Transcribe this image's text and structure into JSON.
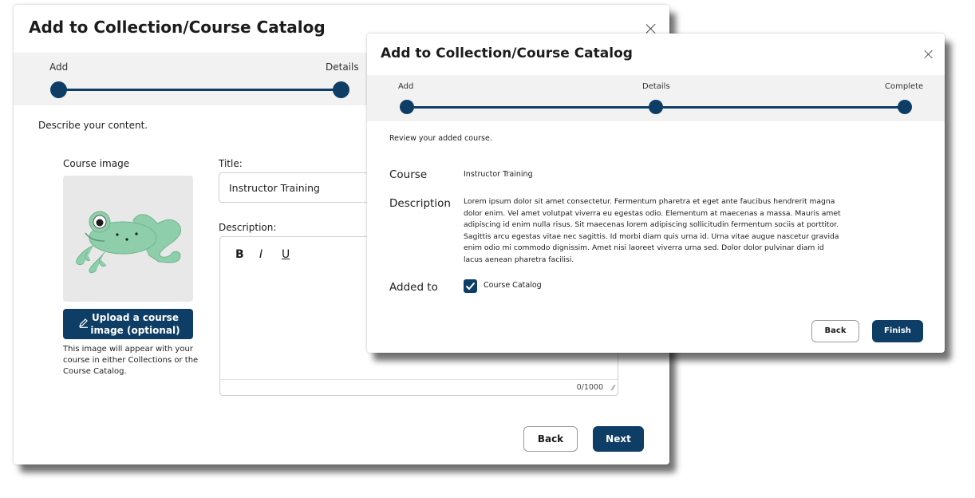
{
  "colors": {
    "accent": "#0e3d66",
    "band": "#f2f2f2"
  },
  "back_modal": {
    "title": "Add to Collection/Course Catalog",
    "steps": [
      "Add",
      "Details"
    ],
    "instruction": "Describe your content.",
    "course_image_label": "Course image",
    "upload_button": "Upload a course image (optional)",
    "upload_button_line1": "Upload a course",
    "upload_button_line2": "image (optional)",
    "upload_help": "This image will appear with your course in either Collections or the Course Catalog.",
    "title_label": "Title:",
    "title_value": "Instructor Training",
    "description_label": "Description:",
    "format_buttons": [
      "B",
      "I",
      "U"
    ],
    "char_counter": "0/1000",
    "back_button": "Back",
    "next_button": "Next",
    "icons": [
      "close-icon",
      "pencil-icon",
      "frog-illustration",
      "resize-handle-icon"
    ]
  },
  "front_modal": {
    "title": "Add to Collection/Course Catalog",
    "steps": [
      "Add",
      "Details",
      "Complete"
    ],
    "instruction": "Review your added course.",
    "course_label": "Course",
    "course_value": "Instructor Training",
    "description_label": "Description",
    "description_lines": [
      "Lorem ipsum dolor sit amet consectetur. Fermentum pharetra et eget ante faucibus hendrerit magna",
      "dolor enim. Vel amet volutpat viverra eu egestas odio. Elementum at maecenas a massa. Mauris amet",
      "adipiscing id enim nulla risus. Sit maecenas lorem adipiscing sollicitudin fermentum sociis at porttitor.",
      "Sagittis arcu egestas vitae nec sagittis. Id morbi diam quis urna id. Urna vitae augue nascetur gravida",
      "enim odio mi commodo dignissim. Amet nisi laoreet viverra urna sed. Dolor dolor pulvinar diam id",
      "lacus aenean pharetra facilisi."
    ],
    "added_to_label": "Added to",
    "added_to_value": "Course Catalog",
    "added_to_checked": true,
    "back_button": "Back",
    "finish_button": "Finish",
    "icons": [
      "close-icon",
      "checkmark-icon"
    ]
  }
}
